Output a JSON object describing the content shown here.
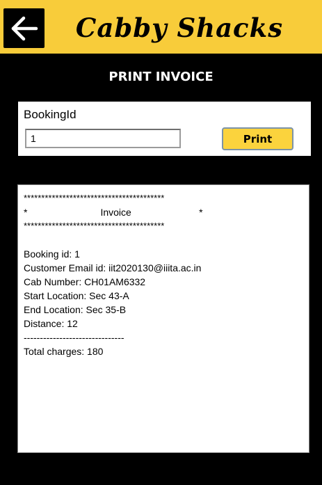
{
  "header": {
    "app_title": "Cabby Shacks",
    "back_icon": "arrow-left-icon",
    "accent_color": "#f8cc3a"
  },
  "page": {
    "heading": "PRINT INVOICE"
  },
  "form": {
    "booking_label": "BookingId",
    "booking_value": "1",
    "print_label": "Print"
  },
  "invoice": {
    "border_line": "****************************************",
    "title_line": "*                           Invoice                         *",
    "booking_id": "Booking id: 1",
    "customer_email": "Customer Email id: iit2020130@iiita.ac.in",
    "cab_number": "Cab Number: CH01AM6332",
    "start_location": "Start Location: Sec 43-A",
    "end_location": "End Location: Sec 35-B",
    "distance": "Distance: 12",
    "separator": "-------------------------------",
    "total_charges": "Total charges: 180"
  }
}
